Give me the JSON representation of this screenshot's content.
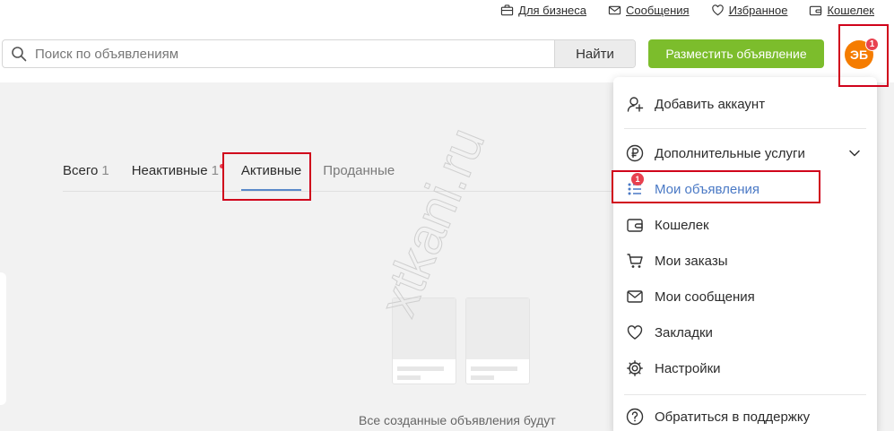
{
  "colors": {
    "accent_green": "#7cbd2c",
    "avatar_orange": "#f57c00",
    "badge_red": "#e8414f",
    "highlight_red": "#d0021b",
    "link_blue": "#4a79c5"
  },
  "header": {
    "top_links": [
      {
        "label": "Для бизнеса",
        "icon": "briefcase-icon"
      },
      {
        "label": "Сообщения",
        "icon": "envelope-icon"
      },
      {
        "label": "Избранное",
        "icon": "heart-icon"
      },
      {
        "label": "Кошелек",
        "icon": "wallet-icon"
      }
    ],
    "search": {
      "placeholder": "Поиск по объявлениям",
      "value": "",
      "button_label": "Найти"
    },
    "post_button_label": "Разместить объявление",
    "avatar": {
      "initials": "ЭБ",
      "badge": "1"
    }
  },
  "tabs": [
    {
      "label": "Всего",
      "count": "1"
    },
    {
      "label": "Неактивные",
      "count": "1"
    },
    {
      "label": "Активные",
      "count": ""
    },
    {
      "label": "Проданные",
      "count": ""
    }
  ],
  "active_tab": "Активные",
  "empty_state": {
    "text": "Все созданные объявления будут"
  },
  "watermark": "xtkani.ru",
  "menu": {
    "items": [
      {
        "label": "Добавить аккаунт",
        "icon": "add-account-icon"
      },
      {
        "label": "Дополнительные услуги",
        "icon": "ruble-icon"
      },
      {
        "label": "Мои объявления",
        "icon": "listings-icon",
        "badge": "1",
        "selected": true
      },
      {
        "label": "Кошелек",
        "icon": "wallet-icon"
      },
      {
        "label": "Мои заказы",
        "icon": "cart-icon"
      },
      {
        "label": "Мои сообщения",
        "icon": "envelope-icon"
      },
      {
        "label": "Закладки",
        "icon": "heart-icon"
      },
      {
        "label": "Настройки",
        "icon": "gear-icon"
      },
      {
        "label": "Обратиться в поддержку",
        "icon": "help-icon"
      }
    ]
  }
}
